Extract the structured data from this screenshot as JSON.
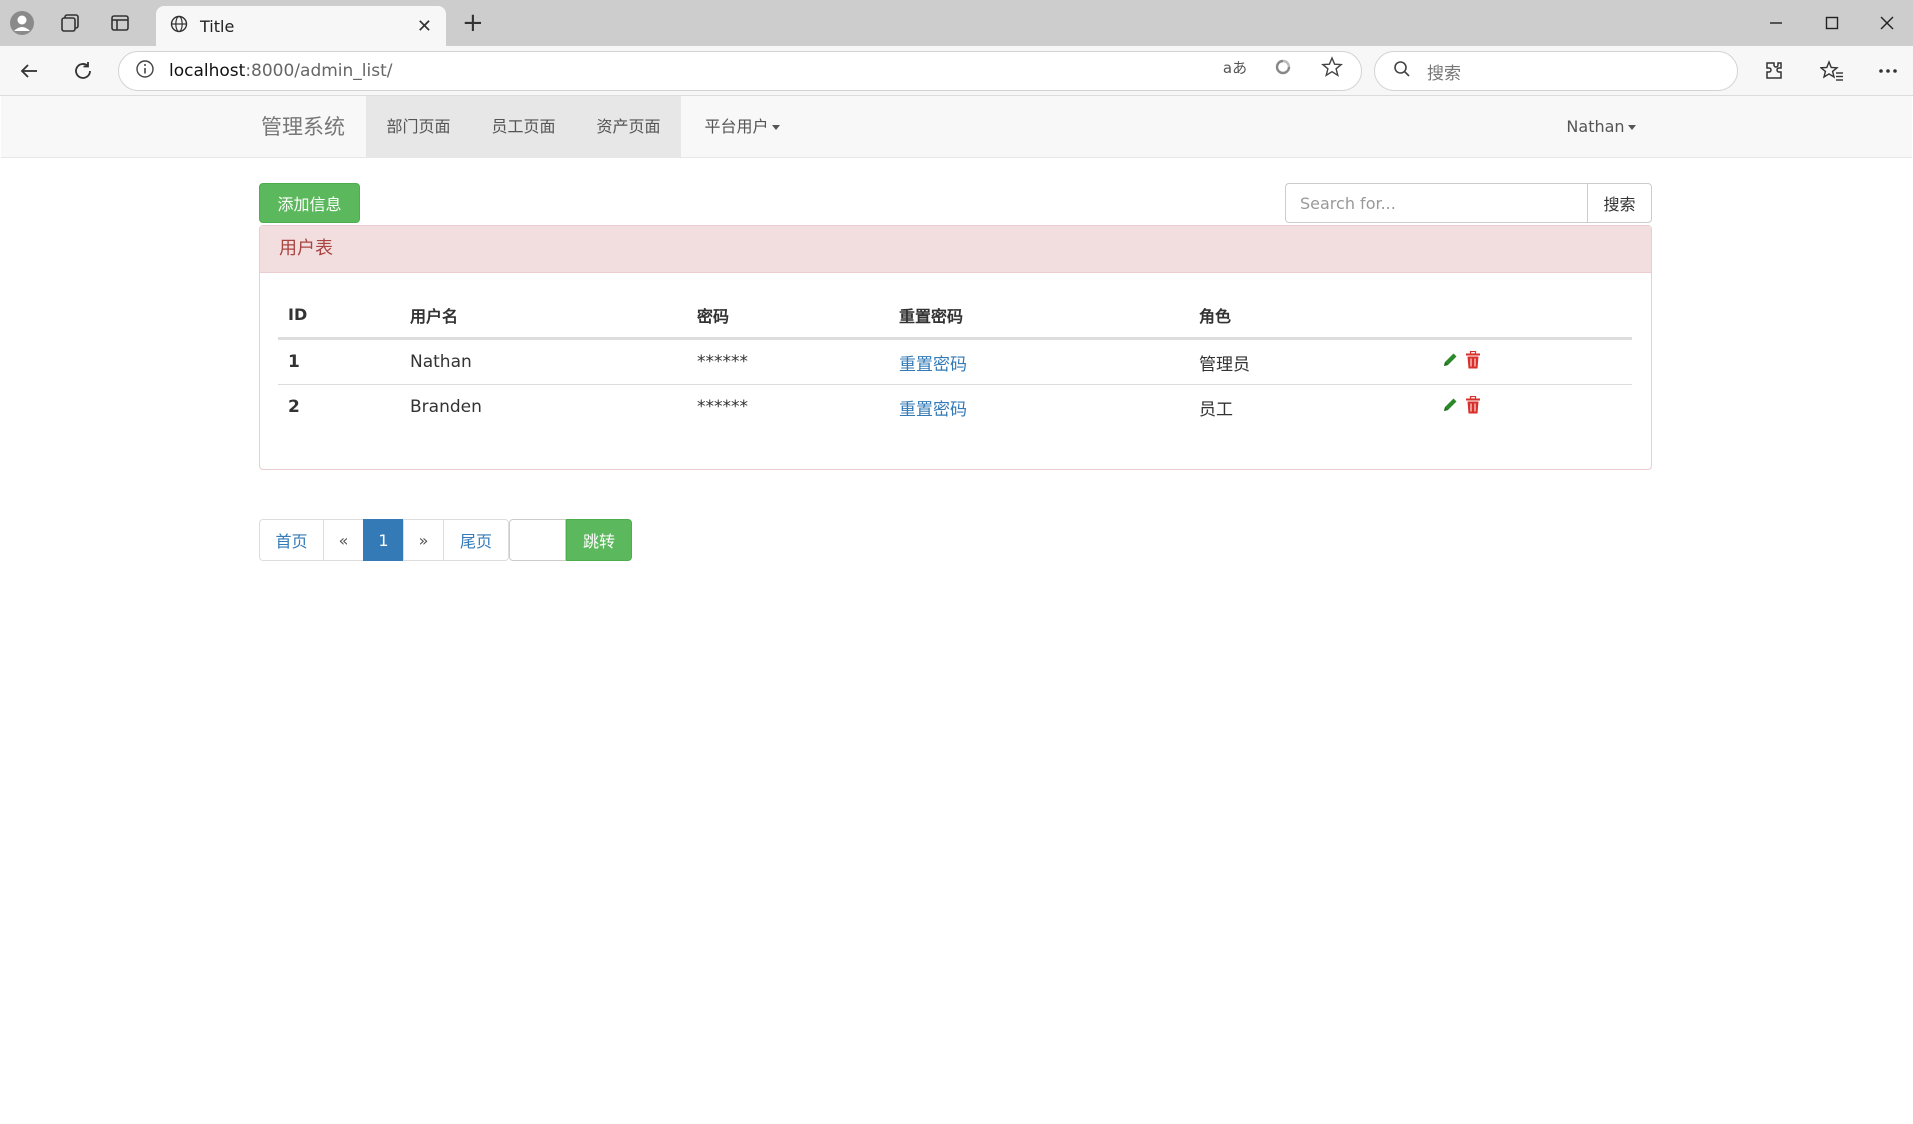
{
  "browser": {
    "tab_title": "Title",
    "tab_close": "✕",
    "new_tab": "+",
    "url_host": "localhost",
    "url_rest": ":8000/admin_list/",
    "search_placeholder": "搜索",
    "read_aloud": "aあ"
  },
  "navbar": {
    "brand": "管理系统",
    "links": [
      "部门页面",
      "员工页面",
      "资产页面"
    ],
    "dropdown": "平台用户",
    "user": "Nathan"
  },
  "toolbar": {
    "add_label": "添加信息",
    "search_placeholder": "Search for...",
    "search_button": "搜索"
  },
  "panel": {
    "title": "用户表",
    "columns": [
      "ID",
      "用户名",
      "密码",
      "重置密码",
      "角色"
    ],
    "rows": [
      {
        "id": "1",
        "username": "Nathan",
        "password": "******",
        "reset": "重置密码",
        "role": "管理员"
      },
      {
        "id": "2",
        "username": "Branden",
        "password": "******",
        "reset": "重置密码",
        "role": "员工"
      }
    ]
  },
  "pagination": {
    "first": "首页",
    "prev": "«",
    "current": "1",
    "next": "»",
    "last": "尾页",
    "go": "跳转"
  },
  "colors": {
    "success": "#5cb85c",
    "primary": "#337ab7",
    "danger_panel": "#f2dede",
    "edit_icon": "#2a8a2a",
    "delete_icon": "#d9302c"
  }
}
